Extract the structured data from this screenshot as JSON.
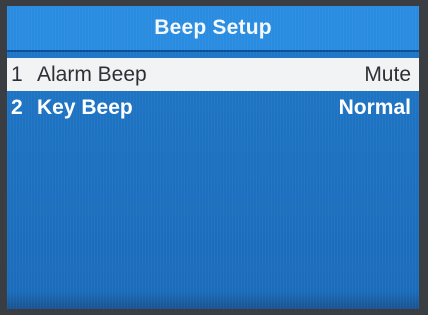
{
  "title": "Beep Setup",
  "menu": {
    "items": [
      {
        "number": "1",
        "label": "Alarm Beep",
        "value": "Mute",
        "selected": true
      },
      {
        "number": "2",
        "label": "Key Beep",
        "value": "Normal",
        "selected": false
      }
    ]
  },
  "colors": {
    "screen_bg": "#1d72c1",
    "title_bar_bg": "#2a8ce0",
    "selected_row_bg": "#f2f3f5",
    "text": "#ffffff",
    "selected_text": "#2a2e33"
  }
}
